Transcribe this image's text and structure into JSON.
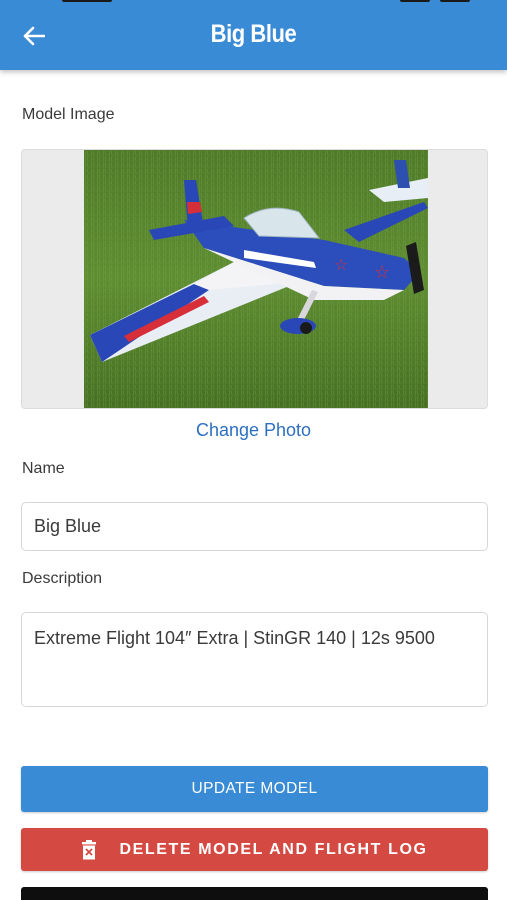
{
  "header": {
    "title": "Big Blue",
    "back_icon": "arrow-left-icon",
    "color": "#3a8bd5"
  },
  "model_image": {
    "label": "Model Image",
    "change_photo_label": "Change Photo"
  },
  "name": {
    "label": "Name",
    "value": "Big Blue"
  },
  "description": {
    "label": "Description",
    "value": "Extreme Flight 104″ Extra | StinGR 140 | 12s 9500"
  },
  "buttons": {
    "update_label": "UPDATE MODEL",
    "delete_label": "DELETE MODEL AND FLIGHT LOG",
    "update_color": "#3a8bd5",
    "delete_color": "#d44a42",
    "delete_icon": "trash-icon"
  }
}
